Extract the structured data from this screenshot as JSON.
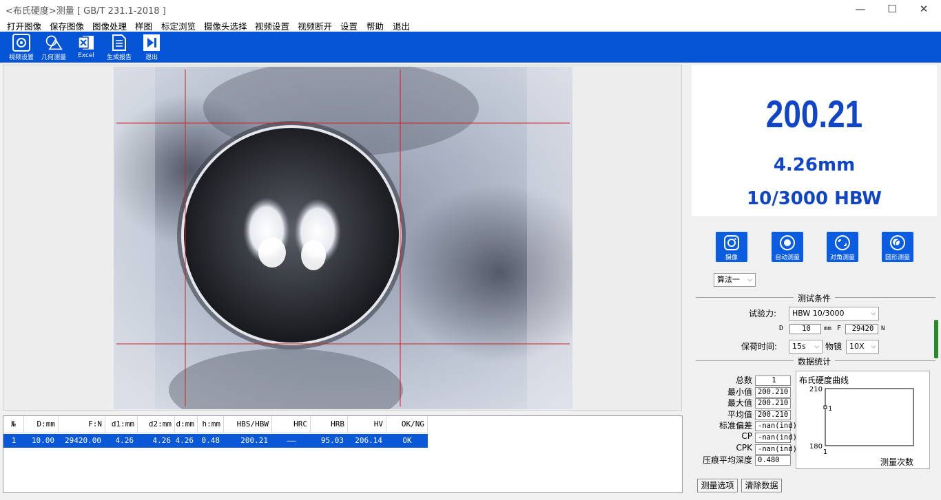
{
  "window": {
    "title": "<布氏硬度>测量 [ GB/T 231.1-2018 ]",
    "controls": [
      "—",
      "☐",
      "✕"
    ]
  },
  "menu": [
    "打开图像",
    "保存图像",
    "图像处理",
    "样图",
    "标定浏览",
    "摄像头选择",
    "视频设置",
    "视频断开",
    "设置",
    "帮助",
    "退出"
  ],
  "toolbar": [
    {
      "label": "视频设置",
      "icon": "video-settings-icon"
    },
    {
      "label": "几何测量",
      "icon": "geometry-icon"
    },
    {
      "label": "Excel",
      "icon": "excel-icon"
    },
    {
      "label": "生成报告",
      "icon": "report-icon"
    },
    {
      "label": "退出",
      "icon": "exit-icon"
    }
  ],
  "table": {
    "headers": [
      "№",
      "D:mm",
      "F:N",
      "d1:mm",
      "d2:mm",
      "d:mm",
      "h:mm",
      "HBS/HBW",
      "HRC",
      "HRB",
      "HV",
      "OK/NG"
    ],
    "rows": [
      [
        "1",
        "10.00",
        "29420.00",
        "4.26",
        "4.26",
        "4.26",
        "0.48",
        "200.21",
        "——",
        "95.03",
        "206.14",
        "OK"
      ]
    ]
  },
  "readout": {
    "hardness": "200.21",
    "diameter": "4.26mm",
    "scale": "10/3000 HBW"
  },
  "actions": [
    {
      "label": "摄像",
      "icon": "camera-icon"
    },
    {
      "label": "自动测量",
      "icon": "auto-measure-icon"
    },
    {
      "label": "对角测量",
      "icon": "diagonal-measure-icon"
    },
    {
      "label": "圆形测量",
      "icon": "circle-measure-icon"
    }
  ],
  "algorithm": {
    "selected": "算法一"
  },
  "conditions": {
    "title": "测试条件",
    "force_label": "试验力:",
    "force_value": "HBW 10/3000",
    "d_label": "D",
    "d_value": "10",
    "d_unit": "mm",
    "f_label": "F",
    "f_value": "29420",
    "f_unit": "N",
    "hold_label": "保荷时间:",
    "hold_value": "15s",
    "objective_label": "物镜",
    "objective_value": "10X"
  },
  "stats": {
    "title": "数据统计",
    "items": [
      {
        "label": "总数",
        "value": "1"
      },
      {
        "label": "最小值",
        "value": "200.210"
      },
      {
        "label": "最大值",
        "value": "200.210"
      },
      {
        "label": "平均值",
        "value": "200.210"
      },
      {
        "label": "标准偏差",
        "value": "-nan(ind)"
      },
      {
        "label": "CP",
        "value": "-nan(ind)"
      },
      {
        "label": "CPK",
        "value": "-nan(ind)"
      },
      {
        "label": "压痕平均深度",
        "value": "0.480"
      }
    ]
  },
  "chart_data": {
    "type": "line",
    "title": "布氏硬度曲线",
    "xlabel": "测量次数",
    "ylabel": "",
    "ylim": [
      180,
      210
    ],
    "yticks": [
      "210",
      "180"
    ],
    "xticks": [
      "1"
    ],
    "series": [
      {
        "values": [
          200.21
        ],
        "labels": [
          "1"
        ]
      }
    ]
  },
  "buttons": {
    "options": "测量选项",
    "clear": "清除数据"
  }
}
